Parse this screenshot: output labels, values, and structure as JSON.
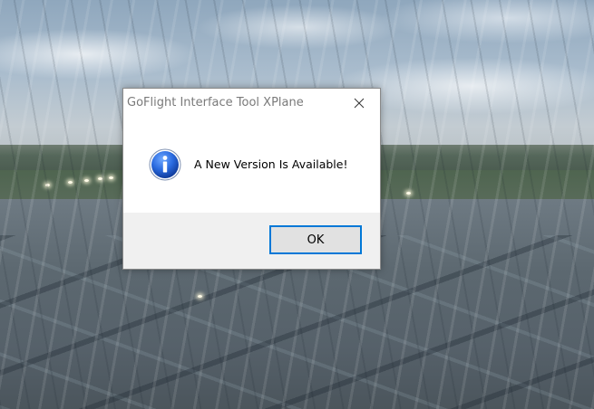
{
  "dialog": {
    "title": "GoFlight Interface Tool XPlane",
    "message": "A New Version Is Available!",
    "ok_label": "OK",
    "icon": "info-icon",
    "close_icon": "close-icon"
  },
  "colors": {
    "accent": "#0078d7",
    "info_blue": "#1c5fc4",
    "footer_bg": "#f0f0f0",
    "title_text": "#7a7a7a"
  }
}
